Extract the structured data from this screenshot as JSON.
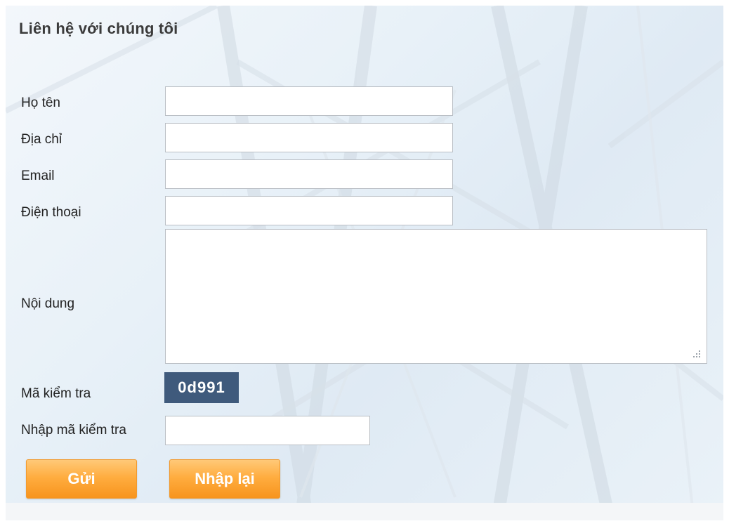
{
  "form": {
    "title": "Liên hệ với chúng tôi",
    "fields": {
      "name_label": "Họ tên",
      "address_label": "Địa chỉ",
      "email_label": "Email",
      "phone_label": "Điện thoại",
      "content_label": "Nội dung",
      "captcha_label": "Mã kiểm tra",
      "captcha_input_label": "Nhập mã kiểm tra"
    },
    "values": {
      "name": "",
      "address": "",
      "email": "",
      "phone": "",
      "content": "",
      "captcha_input": ""
    },
    "captcha_code": "0d991",
    "buttons": {
      "send": "Gửi",
      "reset": "Nhập lại"
    }
  },
  "colors": {
    "captcha_bg": "#3f5a7c",
    "button_orange": "#f7941d",
    "title_text": "#3b3b3b"
  },
  "icons": {
    "textarea_corner": "resize-grip-icon"
  }
}
